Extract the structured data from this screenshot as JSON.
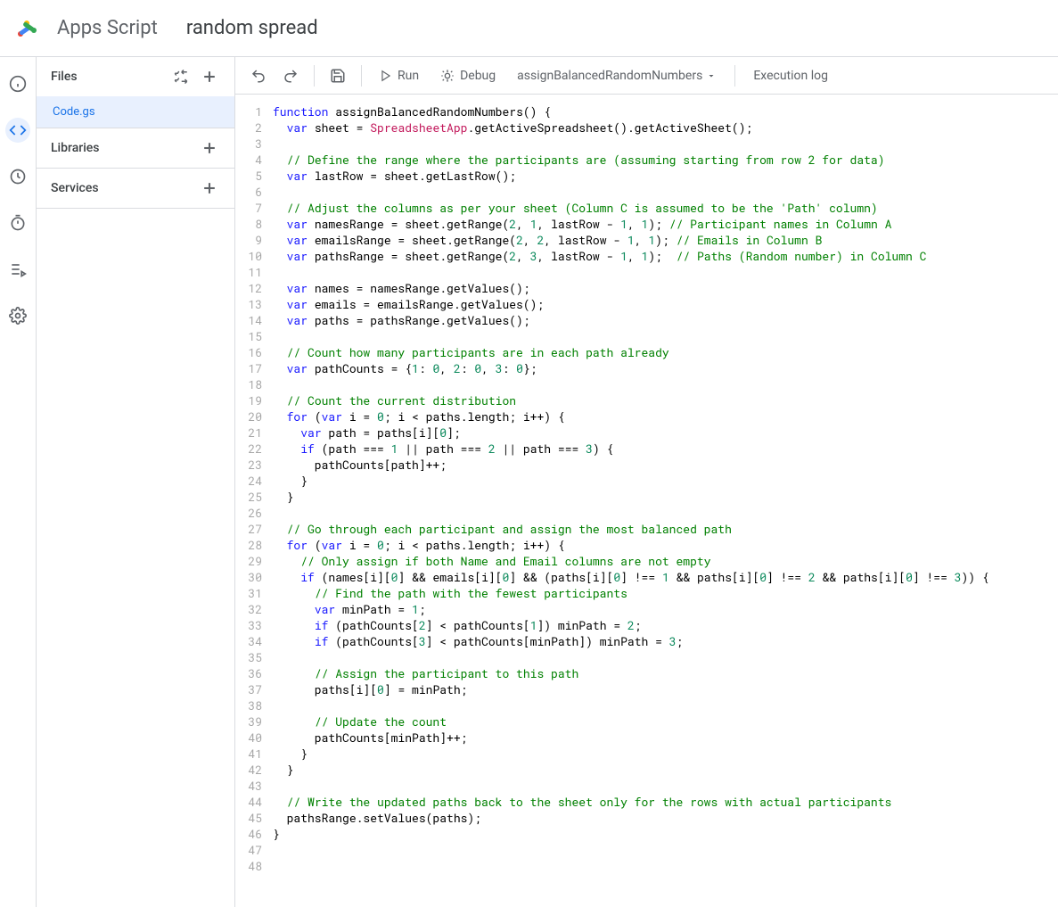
{
  "header": {
    "app_name": "Apps Script",
    "project_name": "random spread"
  },
  "sidebar": {
    "files_label": "Files",
    "file_item": "Code.gs",
    "libraries_label": "Libraries",
    "services_label": "Services"
  },
  "toolbar": {
    "run_label": "Run",
    "debug_label": "Debug",
    "function_name": "assignBalancedRandomNumbers",
    "execution_log": "Execution log"
  },
  "code_lines": [
    [
      {
        "t": "kw",
        "v": "function"
      },
      {
        "t": "p",
        "v": " "
      },
      {
        "t": "fn",
        "v": "assignBalancedRandomNumbers"
      },
      {
        "t": "p",
        "v": "() {"
      }
    ],
    [
      {
        "t": "p",
        "v": "  "
      },
      {
        "t": "kw",
        "v": "var"
      },
      {
        "t": "p",
        "v": " sheet = "
      },
      {
        "t": "attr",
        "v": "SpreadsheetApp"
      },
      {
        "t": "p",
        "v": ".getActiveSpreadsheet().getActiveSheet();"
      }
    ],
    [],
    [
      {
        "t": "p",
        "v": "  "
      },
      {
        "t": "com",
        "v": "// Define the range where the participants are (assuming starting from row 2 for data)"
      }
    ],
    [
      {
        "t": "p",
        "v": "  "
      },
      {
        "t": "kw",
        "v": "var"
      },
      {
        "t": "p",
        "v": " lastRow = sheet.getLastRow();"
      }
    ],
    [],
    [
      {
        "t": "p",
        "v": "  "
      },
      {
        "t": "com",
        "v": "// Adjust the columns as per your sheet (Column C is assumed to be the 'Path' column)"
      }
    ],
    [
      {
        "t": "p",
        "v": "  "
      },
      {
        "t": "kw",
        "v": "var"
      },
      {
        "t": "p",
        "v": " namesRange = sheet.getRange("
      },
      {
        "t": "num",
        "v": "2"
      },
      {
        "t": "p",
        "v": ", "
      },
      {
        "t": "num",
        "v": "1"
      },
      {
        "t": "p",
        "v": ", lastRow - "
      },
      {
        "t": "num",
        "v": "1"
      },
      {
        "t": "p",
        "v": ", "
      },
      {
        "t": "num",
        "v": "1"
      },
      {
        "t": "p",
        "v": "); "
      },
      {
        "t": "com",
        "v": "// Participant names in Column A"
      }
    ],
    [
      {
        "t": "p",
        "v": "  "
      },
      {
        "t": "kw",
        "v": "var"
      },
      {
        "t": "p",
        "v": " emailsRange = sheet.getRange("
      },
      {
        "t": "num",
        "v": "2"
      },
      {
        "t": "p",
        "v": ", "
      },
      {
        "t": "num",
        "v": "2"
      },
      {
        "t": "p",
        "v": ", lastRow - "
      },
      {
        "t": "num",
        "v": "1"
      },
      {
        "t": "p",
        "v": ", "
      },
      {
        "t": "num",
        "v": "1"
      },
      {
        "t": "p",
        "v": "); "
      },
      {
        "t": "com",
        "v": "// Emails in Column B"
      }
    ],
    [
      {
        "t": "p",
        "v": "  "
      },
      {
        "t": "kw",
        "v": "var"
      },
      {
        "t": "p",
        "v": " pathsRange = sheet.getRange("
      },
      {
        "t": "num",
        "v": "2"
      },
      {
        "t": "p",
        "v": ", "
      },
      {
        "t": "num",
        "v": "3"
      },
      {
        "t": "p",
        "v": ", lastRow - "
      },
      {
        "t": "num",
        "v": "1"
      },
      {
        "t": "p",
        "v": ", "
      },
      {
        "t": "num",
        "v": "1"
      },
      {
        "t": "p",
        "v": ");  "
      },
      {
        "t": "com",
        "v": "// Paths (Random number) in Column C"
      }
    ],
    [],
    [
      {
        "t": "p",
        "v": "  "
      },
      {
        "t": "kw",
        "v": "var"
      },
      {
        "t": "p",
        "v": " names = namesRange.getValues();"
      }
    ],
    [
      {
        "t": "p",
        "v": "  "
      },
      {
        "t": "kw",
        "v": "var"
      },
      {
        "t": "p",
        "v": " emails = emailsRange.getValues();"
      }
    ],
    [
      {
        "t": "p",
        "v": "  "
      },
      {
        "t": "kw",
        "v": "var"
      },
      {
        "t": "p",
        "v": " paths = pathsRange.getValues();"
      }
    ],
    [],
    [
      {
        "t": "p",
        "v": "  "
      },
      {
        "t": "com",
        "v": "// Count how many participants are in each path already"
      }
    ],
    [
      {
        "t": "p",
        "v": "  "
      },
      {
        "t": "kw",
        "v": "var"
      },
      {
        "t": "p",
        "v": " pathCounts = {"
      },
      {
        "t": "num",
        "v": "1"
      },
      {
        "t": "p",
        "v": ": "
      },
      {
        "t": "num",
        "v": "0"
      },
      {
        "t": "p",
        "v": ", "
      },
      {
        "t": "num",
        "v": "2"
      },
      {
        "t": "p",
        "v": ": "
      },
      {
        "t": "num",
        "v": "0"
      },
      {
        "t": "p",
        "v": ", "
      },
      {
        "t": "num",
        "v": "3"
      },
      {
        "t": "p",
        "v": ": "
      },
      {
        "t": "num",
        "v": "0"
      },
      {
        "t": "p",
        "v": "};"
      }
    ],
    [],
    [
      {
        "t": "p",
        "v": "  "
      },
      {
        "t": "com",
        "v": "// Count the current distribution"
      }
    ],
    [
      {
        "t": "p",
        "v": "  "
      },
      {
        "t": "kw",
        "v": "for"
      },
      {
        "t": "p",
        "v": " ("
      },
      {
        "t": "kw",
        "v": "var"
      },
      {
        "t": "p",
        "v": " i = "
      },
      {
        "t": "num",
        "v": "0"
      },
      {
        "t": "p",
        "v": "; i < paths.length; i++) {"
      }
    ],
    [
      {
        "t": "p",
        "v": "    "
      },
      {
        "t": "kw",
        "v": "var"
      },
      {
        "t": "p",
        "v": " path = paths[i]["
      },
      {
        "t": "num",
        "v": "0"
      },
      {
        "t": "p",
        "v": "];"
      }
    ],
    [
      {
        "t": "p",
        "v": "    "
      },
      {
        "t": "kw",
        "v": "if"
      },
      {
        "t": "p",
        "v": " (path === "
      },
      {
        "t": "num",
        "v": "1"
      },
      {
        "t": "p",
        "v": " || path === "
      },
      {
        "t": "num",
        "v": "2"
      },
      {
        "t": "p",
        "v": " || path === "
      },
      {
        "t": "num",
        "v": "3"
      },
      {
        "t": "p",
        "v": ") {"
      }
    ],
    [
      {
        "t": "p",
        "v": "      pathCounts[path]++;"
      }
    ],
    [
      {
        "t": "p",
        "v": "    }"
      }
    ],
    [
      {
        "t": "p",
        "v": "  }"
      }
    ],
    [],
    [
      {
        "t": "p",
        "v": "  "
      },
      {
        "t": "com",
        "v": "// Go through each participant and assign the most balanced path"
      }
    ],
    [
      {
        "t": "p",
        "v": "  "
      },
      {
        "t": "kw",
        "v": "for"
      },
      {
        "t": "p",
        "v": " ("
      },
      {
        "t": "kw",
        "v": "var"
      },
      {
        "t": "p",
        "v": " i = "
      },
      {
        "t": "num",
        "v": "0"
      },
      {
        "t": "p",
        "v": "; i < paths.length; i++) {"
      }
    ],
    [
      {
        "t": "p",
        "v": "    "
      },
      {
        "t": "com",
        "v": "// Only assign if both Name and Email columns are not empty"
      }
    ],
    [
      {
        "t": "p",
        "v": "    "
      },
      {
        "t": "kw",
        "v": "if"
      },
      {
        "t": "p",
        "v": " (names[i]["
      },
      {
        "t": "num",
        "v": "0"
      },
      {
        "t": "p",
        "v": "] && emails[i]["
      },
      {
        "t": "num",
        "v": "0"
      },
      {
        "t": "p",
        "v": "] && (paths[i]["
      },
      {
        "t": "num",
        "v": "0"
      },
      {
        "t": "p",
        "v": "] !== "
      },
      {
        "t": "num",
        "v": "1"
      },
      {
        "t": "p",
        "v": " && paths[i]["
      },
      {
        "t": "num",
        "v": "0"
      },
      {
        "t": "p",
        "v": "] !== "
      },
      {
        "t": "num",
        "v": "2"
      },
      {
        "t": "p",
        "v": " && paths[i]["
      },
      {
        "t": "num",
        "v": "0"
      },
      {
        "t": "p",
        "v": "] !== "
      },
      {
        "t": "num",
        "v": "3"
      },
      {
        "t": "p",
        "v": ")) {"
      }
    ],
    [
      {
        "t": "p",
        "v": "      "
      },
      {
        "t": "com",
        "v": "// Find the path with the fewest participants"
      }
    ],
    [
      {
        "t": "p",
        "v": "      "
      },
      {
        "t": "kw",
        "v": "var"
      },
      {
        "t": "p",
        "v": " minPath = "
      },
      {
        "t": "num",
        "v": "1"
      },
      {
        "t": "p",
        "v": ";"
      }
    ],
    [
      {
        "t": "p",
        "v": "      "
      },
      {
        "t": "kw",
        "v": "if"
      },
      {
        "t": "p",
        "v": " (pathCounts["
      },
      {
        "t": "num",
        "v": "2"
      },
      {
        "t": "p",
        "v": "] < pathCounts["
      },
      {
        "t": "num",
        "v": "1"
      },
      {
        "t": "p",
        "v": "]) minPath = "
      },
      {
        "t": "num",
        "v": "2"
      },
      {
        "t": "p",
        "v": ";"
      }
    ],
    [
      {
        "t": "p",
        "v": "      "
      },
      {
        "t": "kw",
        "v": "if"
      },
      {
        "t": "p",
        "v": " (pathCounts["
      },
      {
        "t": "num",
        "v": "3"
      },
      {
        "t": "p",
        "v": "] < pathCounts[minPath]) minPath = "
      },
      {
        "t": "num",
        "v": "3"
      },
      {
        "t": "p",
        "v": ";"
      }
    ],
    [],
    [
      {
        "t": "p",
        "v": "      "
      },
      {
        "t": "com",
        "v": "// Assign the participant to this path"
      }
    ],
    [
      {
        "t": "p",
        "v": "      paths[i]["
      },
      {
        "t": "num",
        "v": "0"
      },
      {
        "t": "p",
        "v": "] = minPath;"
      }
    ],
    [],
    [
      {
        "t": "p",
        "v": "      "
      },
      {
        "t": "com",
        "v": "// Update the count"
      }
    ],
    [
      {
        "t": "p",
        "v": "      pathCounts[minPath]++;"
      }
    ],
    [
      {
        "t": "p",
        "v": "    }"
      }
    ],
    [
      {
        "t": "p",
        "v": "  }"
      }
    ],
    [],
    [
      {
        "t": "p",
        "v": "  "
      },
      {
        "t": "com",
        "v": "// Write the updated paths back to the sheet only for the rows with actual participants"
      }
    ],
    [
      {
        "t": "p",
        "v": "  pathsRange.setValues(paths);"
      }
    ],
    [
      {
        "t": "p",
        "v": "}"
      }
    ],
    [],
    []
  ]
}
